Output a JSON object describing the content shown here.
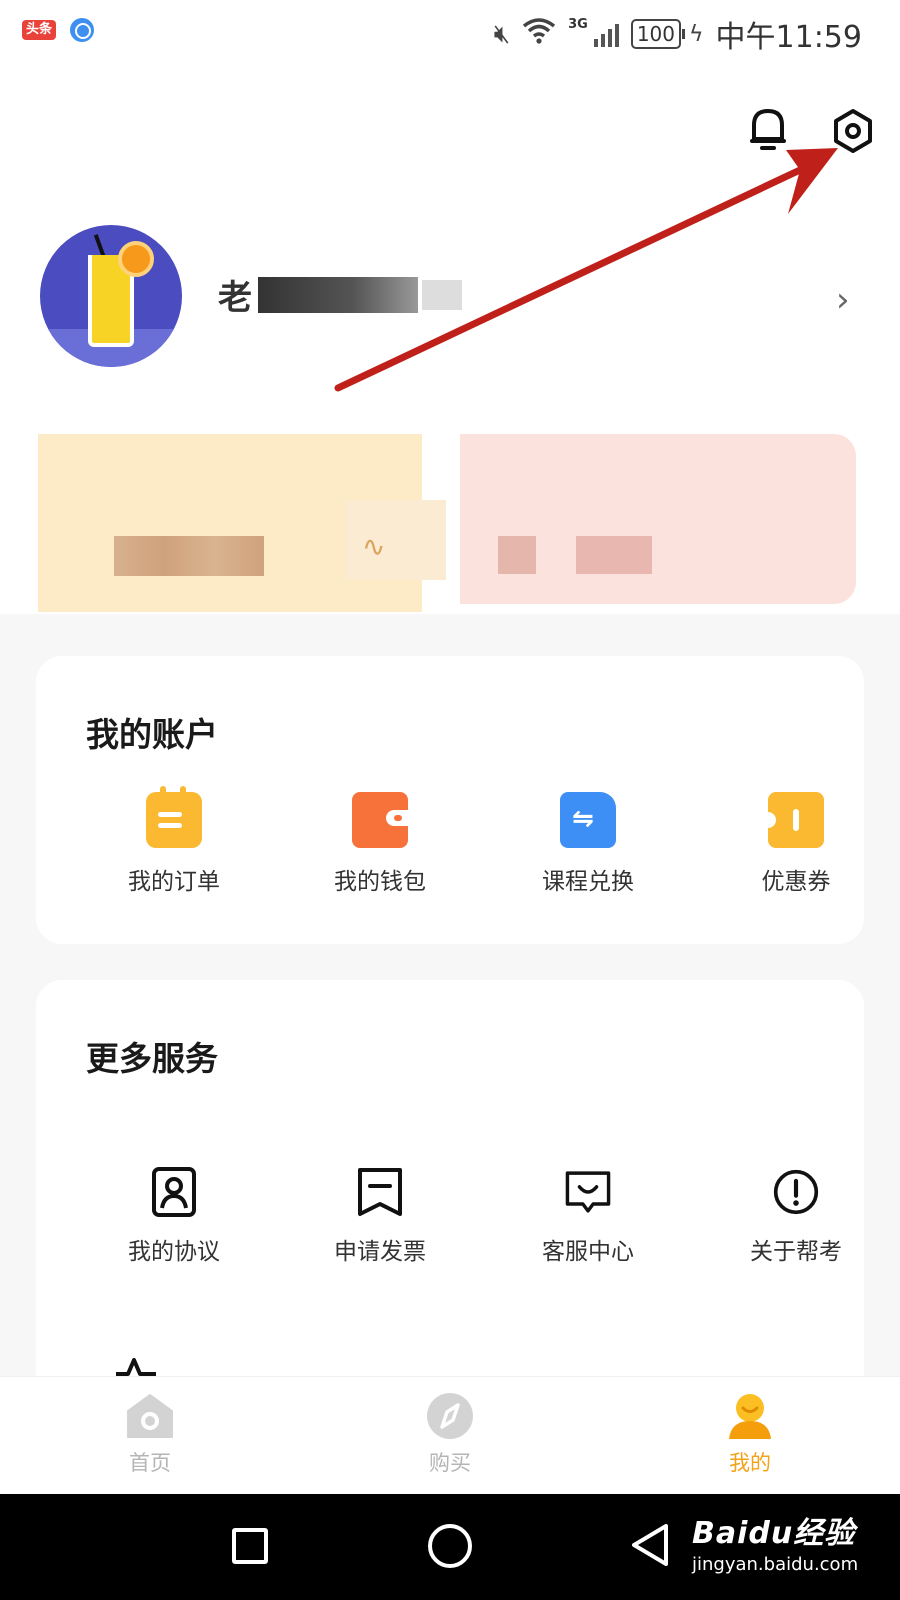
{
  "status_bar": {
    "app_badge": "头条",
    "network": "3G",
    "battery": "100",
    "time": "中午11:59"
  },
  "header": {
    "bell_icon": "bell-icon",
    "settings_icon": "settings-gear-icon"
  },
  "profile": {
    "name_prefix": "老",
    "chevron": "›"
  },
  "account_section": {
    "title": "我的账户",
    "items": [
      {
        "label": "我的订单",
        "icon": "order-icon",
        "color": "#FBB831"
      },
      {
        "label": "我的钱包",
        "icon": "wallet-icon",
        "color": "#F7713A"
      },
      {
        "label": "课程兑换",
        "icon": "exchange-icon",
        "color": "#3E8FF5"
      },
      {
        "label": "优惠券",
        "icon": "coupon-icon",
        "color": "#FBB831"
      }
    ]
  },
  "services_section": {
    "title": "更多服务",
    "items": [
      {
        "label": "我的协议",
        "icon": "agreement-icon"
      },
      {
        "label": "申请发票",
        "icon": "invoice-icon"
      },
      {
        "label": "客服中心",
        "icon": "customer-service-icon"
      },
      {
        "label": "关于帮考",
        "icon": "about-icon"
      }
    ]
  },
  "tabbar": {
    "tabs": [
      {
        "label": "首页",
        "icon": "home-icon",
        "active": false
      },
      {
        "label": "购买",
        "icon": "compass-icon",
        "active": false
      },
      {
        "label": "我的",
        "icon": "profile-icon",
        "active": true
      }
    ],
    "active_color": "#F3A21A",
    "inactive_color": "#B5B5B5"
  },
  "watermark": {
    "brand": "Baidu经验",
    "url": "jingyan.baidu.com"
  },
  "colors": {
    "annotation_arrow": "#C0201A",
    "page_background": "#F7F7F7"
  }
}
